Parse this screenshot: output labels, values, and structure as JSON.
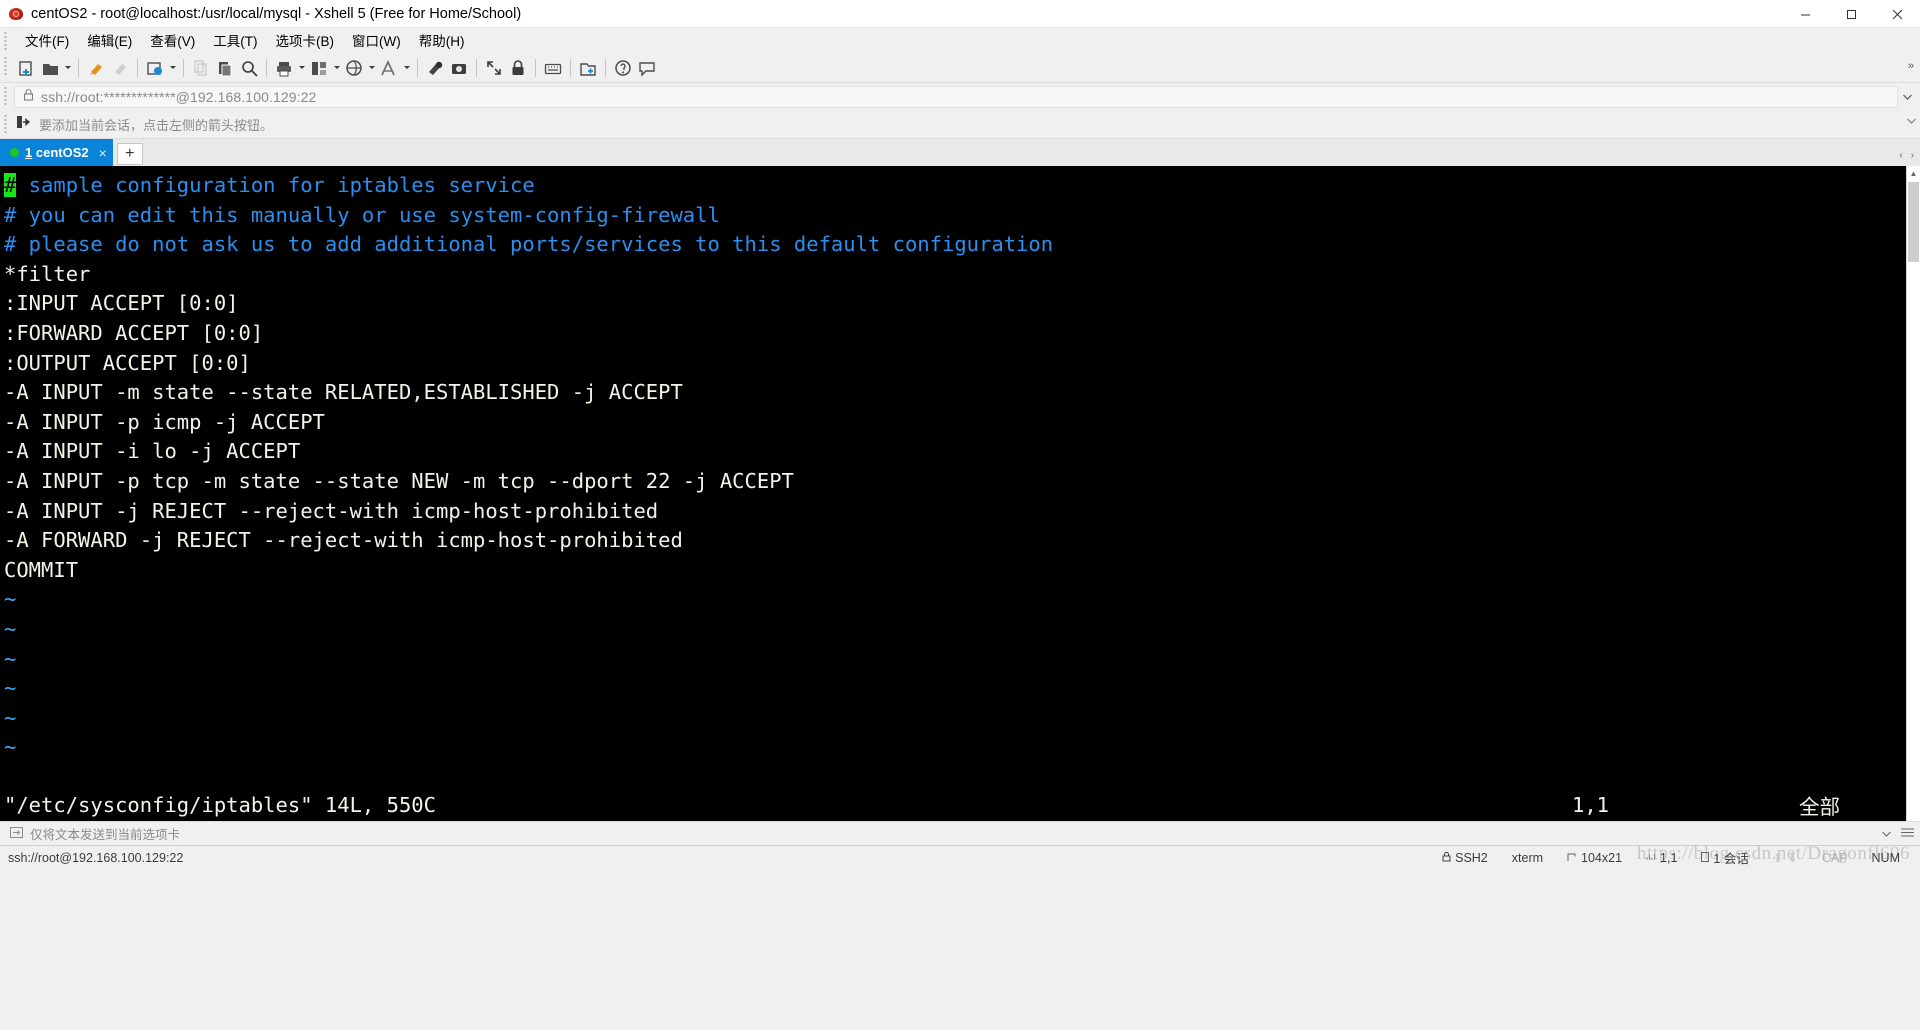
{
  "window": {
    "title": "centOS2 - root@localhost:/usr/local/mysql - Xshell 5 (Free for Home/School)",
    "icon": "xshell-snail-icon",
    "minimize_label": "–",
    "maximize_label": "❐",
    "close_label": "✕"
  },
  "menubar": {
    "items": [
      {
        "label": "文件(F)",
        "name": "menu-file"
      },
      {
        "label": "编辑(E)",
        "name": "menu-edit"
      },
      {
        "label": "查看(V)",
        "name": "menu-view"
      },
      {
        "label": "工具(T)",
        "name": "menu-tools"
      },
      {
        "label": "选项卡(B)",
        "name": "menu-tabs"
      },
      {
        "label": "窗口(W)",
        "name": "menu-window"
      },
      {
        "label": "帮助(H)",
        "name": "menu-help"
      }
    ]
  },
  "toolbar": {
    "overflow_label": "»",
    "buttons": [
      {
        "name": "new-session-icon",
        "dropdown": false,
        "dim": false
      },
      {
        "name": "open-session-icon",
        "dropdown": true,
        "dim": false
      },
      {
        "name": "sep"
      },
      {
        "name": "connect-icon",
        "dropdown": false,
        "dim": false
      },
      {
        "name": "disconnect-icon",
        "dropdown": false,
        "dim": true
      },
      {
        "name": "sep"
      },
      {
        "name": "session-properties-icon",
        "dropdown": true,
        "dim": false
      },
      {
        "name": "sep"
      },
      {
        "name": "copy-icon",
        "dropdown": false,
        "dim": true
      },
      {
        "name": "paste-icon",
        "dropdown": false,
        "dim": false
      },
      {
        "name": "find-icon",
        "dropdown": false,
        "dim": false
      },
      {
        "name": "sep"
      },
      {
        "name": "print-icon",
        "dropdown": true,
        "dim": false
      },
      {
        "name": "layout-icon",
        "dropdown": true,
        "dim": false
      },
      {
        "name": "transfer-icon",
        "dropdown": true,
        "dim": false
      },
      {
        "name": "font-icon",
        "dropdown": true,
        "dim": false
      },
      {
        "name": "sep"
      },
      {
        "name": "start-log-icon",
        "dropdown": false,
        "dim": false
      },
      {
        "name": "screen-capture-icon",
        "dropdown": false,
        "dim": false
      },
      {
        "name": "sep"
      },
      {
        "name": "fullscreen-icon",
        "dropdown": false,
        "dim": false
      },
      {
        "name": "lock-icon",
        "dropdown": false,
        "dim": false
      },
      {
        "name": "sep"
      },
      {
        "name": "keyboard-icon",
        "dropdown": false,
        "dim": false
      },
      {
        "name": "sep"
      },
      {
        "name": "new-folder-icon",
        "dropdown": false,
        "dim": false
      },
      {
        "name": "sep"
      },
      {
        "name": "help-icon",
        "dropdown": false,
        "dim": false
      },
      {
        "name": "comment-icon",
        "dropdown": false,
        "dim": false
      }
    ]
  },
  "address": {
    "lock_icon": "lock-icon",
    "value": "ssh://root:*************@192.168.100.129:22",
    "dropdown_icon": "chevron-down-icon"
  },
  "hint": {
    "icon": "add-session-arrow-icon",
    "text": "要添加当前会话，点击左侧的箭头按钮。"
  },
  "tabs": {
    "items": [
      {
        "index": "1",
        "label": "centOS2",
        "status": "connected",
        "close_label": "×"
      }
    ],
    "add_label": "+",
    "nav_prev": "‹",
    "nav_next": "›"
  },
  "terminal": {
    "lines": [
      {
        "text": "# sample configuration for iptables service",
        "color": "comment",
        "cursor": true
      },
      {
        "text": "# you can edit this manually or use system-config-firewall",
        "color": "comment"
      },
      {
        "text": "# please do not ask us to add additional ports/services to this default configuration",
        "color": "comment"
      },
      {
        "text": "*filter",
        "color": "text"
      },
      {
        "text": ":INPUT ACCEPT [0:0]",
        "color": "text"
      },
      {
        "text": ":FORWARD ACCEPT [0:0]",
        "color": "text"
      },
      {
        "text": ":OUTPUT ACCEPT [0:0]",
        "color": "text"
      },
      {
        "text": "-A INPUT -m state --state RELATED,ESTABLISHED -j ACCEPT",
        "color": "text"
      },
      {
        "text": "-A INPUT -p icmp -j ACCEPT",
        "color": "text"
      },
      {
        "text": "-A INPUT -i lo -j ACCEPT",
        "color": "text"
      },
      {
        "text": "-A INPUT -p tcp -m state --state NEW -m tcp --dport 22 -j ACCEPT",
        "color": "text"
      },
      {
        "text": "-A INPUT -j REJECT --reject-with icmp-host-prohibited",
        "color": "text"
      },
      {
        "text": "-A FORWARD -j REJECT --reject-with icmp-host-prohibited",
        "color": "text"
      },
      {
        "text": "COMMIT",
        "color": "text"
      },
      {
        "text": "~",
        "color": "tilde"
      },
      {
        "text": "~",
        "color": "tilde"
      },
      {
        "text": "~",
        "color": "tilde"
      },
      {
        "text": "~",
        "color": "tilde"
      },
      {
        "text": "~",
        "color": "tilde"
      },
      {
        "text": "~",
        "color": "tilde"
      }
    ],
    "status_file": "\"/etc/sysconfig/iptables\" 14L, 550C",
    "status_position": "1,1",
    "status_scroll": "全部",
    "colors": {
      "background": "#000000",
      "comment": "#2a8ff0",
      "text": "#f3f3e8",
      "tilde": "#3aa9f5",
      "cursor_bg": "#19e619"
    }
  },
  "sendbar": {
    "icon": "send-to-tab-icon",
    "text": "仅将文本发送到当前选项卡",
    "collapse_icon": "chevron-down-icon",
    "menu_icon": "hamburger-icon"
  },
  "statusbar": {
    "connection": "ssh://root@192.168.100.129:22",
    "protocol_icon": "lock-icon",
    "protocol": "SSH2",
    "terminal_type": "xterm",
    "size_icon": "resize-icon",
    "size": "104x21",
    "cursor_icon": "cursor-icon",
    "cursor": "1,1",
    "sessions_icon": "sessions-icon",
    "sessions": "1 会话",
    "upload_icon": "upload-arrow-icon",
    "download_icon": "download-arrow-icon",
    "cap": "CAP",
    "num": "NUM",
    "watermark": "https://blog.csdn.net/Dragonfl606"
  }
}
